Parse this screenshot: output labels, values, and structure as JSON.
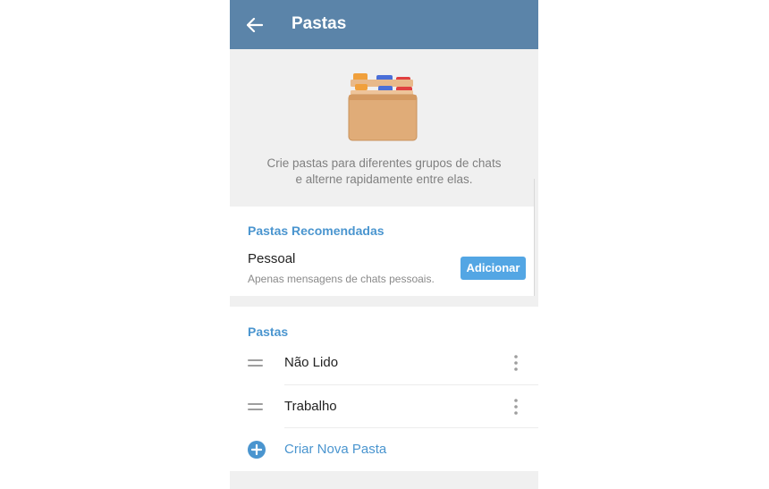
{
  "appbar": {
    "title": "Pastas",
    "back_icon": "arrow-left-icon",
    "color": "#5b84a9"
  },
  "hero": {
    "icon": "folder-box-icon",
    "line1": "Crie pastas para diferentes grupos de chats",
    "line2": "e alterne rapidamente entre elas."
  },
  "recommended": {
    "header": "Pastas Recomendadas",
    "items": [
      {
        "title": "Pessoal",
        "subtitle": "Apenas mensagens de chats pessoais.",
        "button_label": "Adicionar"
      }
    ]
  },
  "folders": {
    "header": "Pastas",
    "items": [
      {
        "name": "Não Lido",
        "handle_icon": "drag-handle-icon",
        "menu_icon": "more-vertical-icon"
      },
      {
        "name": "Trabalho",
        "handle_icon": "drag-handle-icon",
        "menu_icon": "more-vertical-icon"
      }
    ],
    "create_label": "Criar Nova Pasta",
    "create_icon": "plus-circle-icon"
  },
  "colors": {
    "accent": "#4a95cf",
    "button": "#53a6e4",
    "background": "#f0f0f0"
  }
}
